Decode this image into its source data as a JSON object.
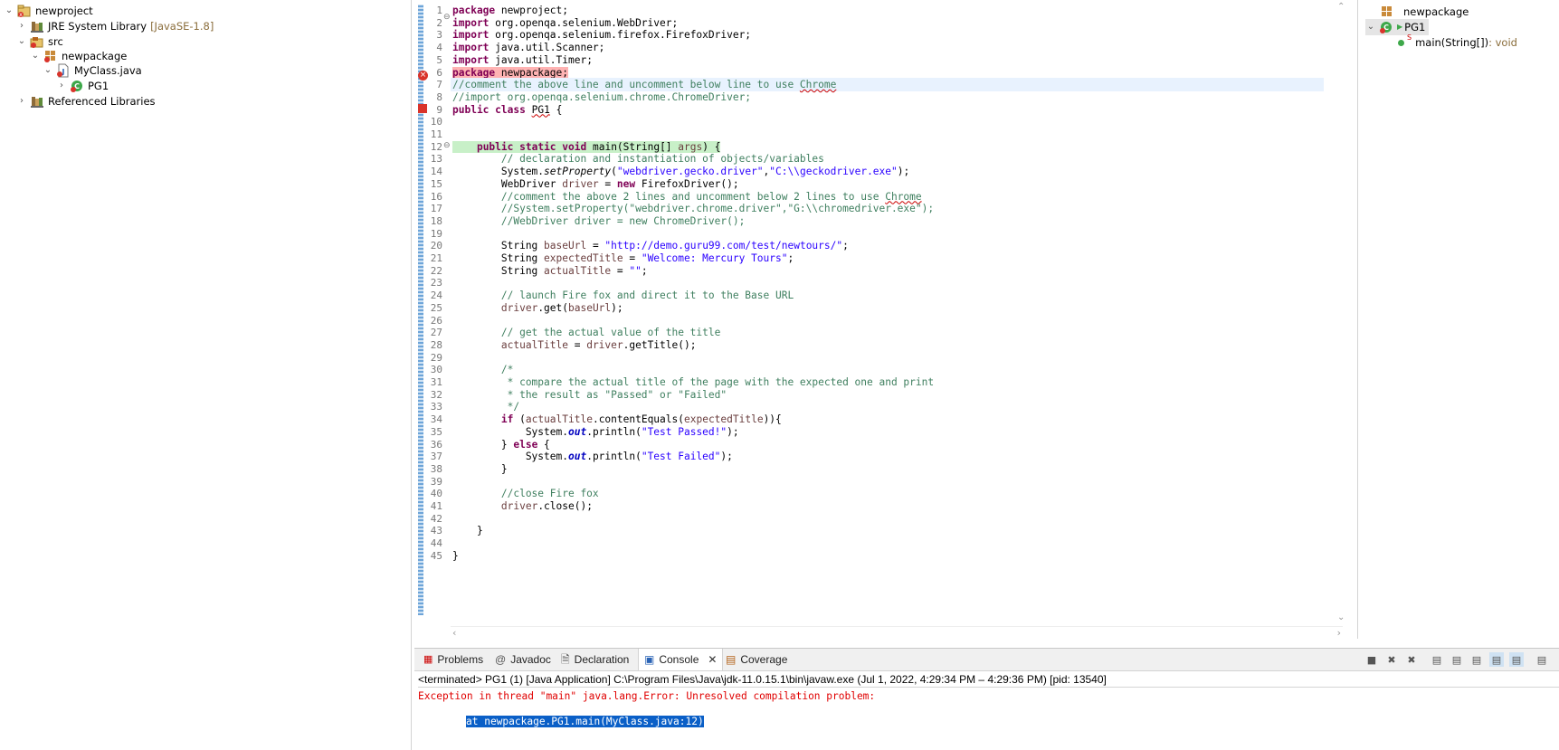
{
  "explorer": {
    "project": "newproject",
    "jre_label": "JRE System Library",
    "jre_deco": "[JavaSE-1.8]",
    "src": "src",
    "package": "newpackage",
    "file": "MyClass.java",
    "class": "PG1",
    "referenced": "Referenced Libraries"
  },
  "editor": {
    "lines": [
      "package newproject;",
      "import org.openqa.selenium.WebDriver;",
      "import org.openqa.selenium.firefox.FirefoxDriver;",
      "import java.util.Scanner;",
      "import java.util.Timer;",
      "package newpackage;",
      "//comment the above line and uncomment below line to use Chrome",
      "//import org.openqa.selenium.chrome.ChromeDriver;",
      "public class PG1 {",
      "",
      "",
      "    public static void main(String[] args) {",
      "        // declaration and instantiation of objects/variables",
      "        System.setProperty(\"webdriver.gecko.driver\",\"C:\\\\geckodriver.exe\");",
      "        WebDriver driver = new FirefoxDriver();",
      "        //comment the above 2 lines and uncomment below 2 lines to use Chrome",
      "        //System.setProperty(\"webdriver.chrome.driver\",\"G:\\\\chromedriver.exe\");",
      "        //WebDriver driver = new ChromeDriver();",
      "",
      "        String baseUrl = \"http://demo.guru99.com/test/newtours/\";",
      "        String expectedTitle = \"Welcome: Mercury Tours\";",
      "        String actualTitle = \"\";",
      "",
      "        // launch Fire fox and direct it to the Base URL",
      "        driver.get(baseUrl);",
      "",
      "        // get the actual value of the title",
      "        actualTitle = driver.getTitle();",
      "",
      "        /*",
      "         * compare the actual title of the page with the expected one and print",
      "         * the result as \"Passed\" or \"Failed\"",
      "         */",
      "        if (actualTitle.contentEquals(expectedTitle)){",
      "            System.out.println(\"Test Passed!\");",
      "        } else {",
      "            System.out.println(\"Test Failed\");",
      "        }",
      "",
      "        //close Fire fox",
      "        driver.close();",
      "",
      "    }",
      "",
      "}"
    ]
  },
  "outline": {
    "package": "newpackage",
    "class": "PG1",
    "method": "main(String[])",
    "method_type": " : void",
    "method_mod": "S"
  },
  "console": {
    "tabs": [
      "Problems",
      "Javadoc",
      "Declaration",
      "Console",
      "Coverage"
    ],
    "active_tab": "Console",
    "terminated": "<terminated> PG1 (1) [Java Application] C:\\Program Files\\Java\\jdk-11.0.15.1\\bin\\javaw.exe  (Jul 1, 2022, 4:29:34 PM – 4:29:36 PM) [pid: 13540]",
    "error_line": "Exception in thread \"main\" java.lang.Error: Unresolved compilation problem: ",
    "stack_line": "at newpackage.PG1.main(MyClass.java:12)"
  },
  "colors": {
    "keyword": "#7f0055",
    "string": "#2a00ff",
    "comment": "#3f7f5f",
    "error_text": "#e00000",
    "selection": "#0a5fc7"
  }
}
